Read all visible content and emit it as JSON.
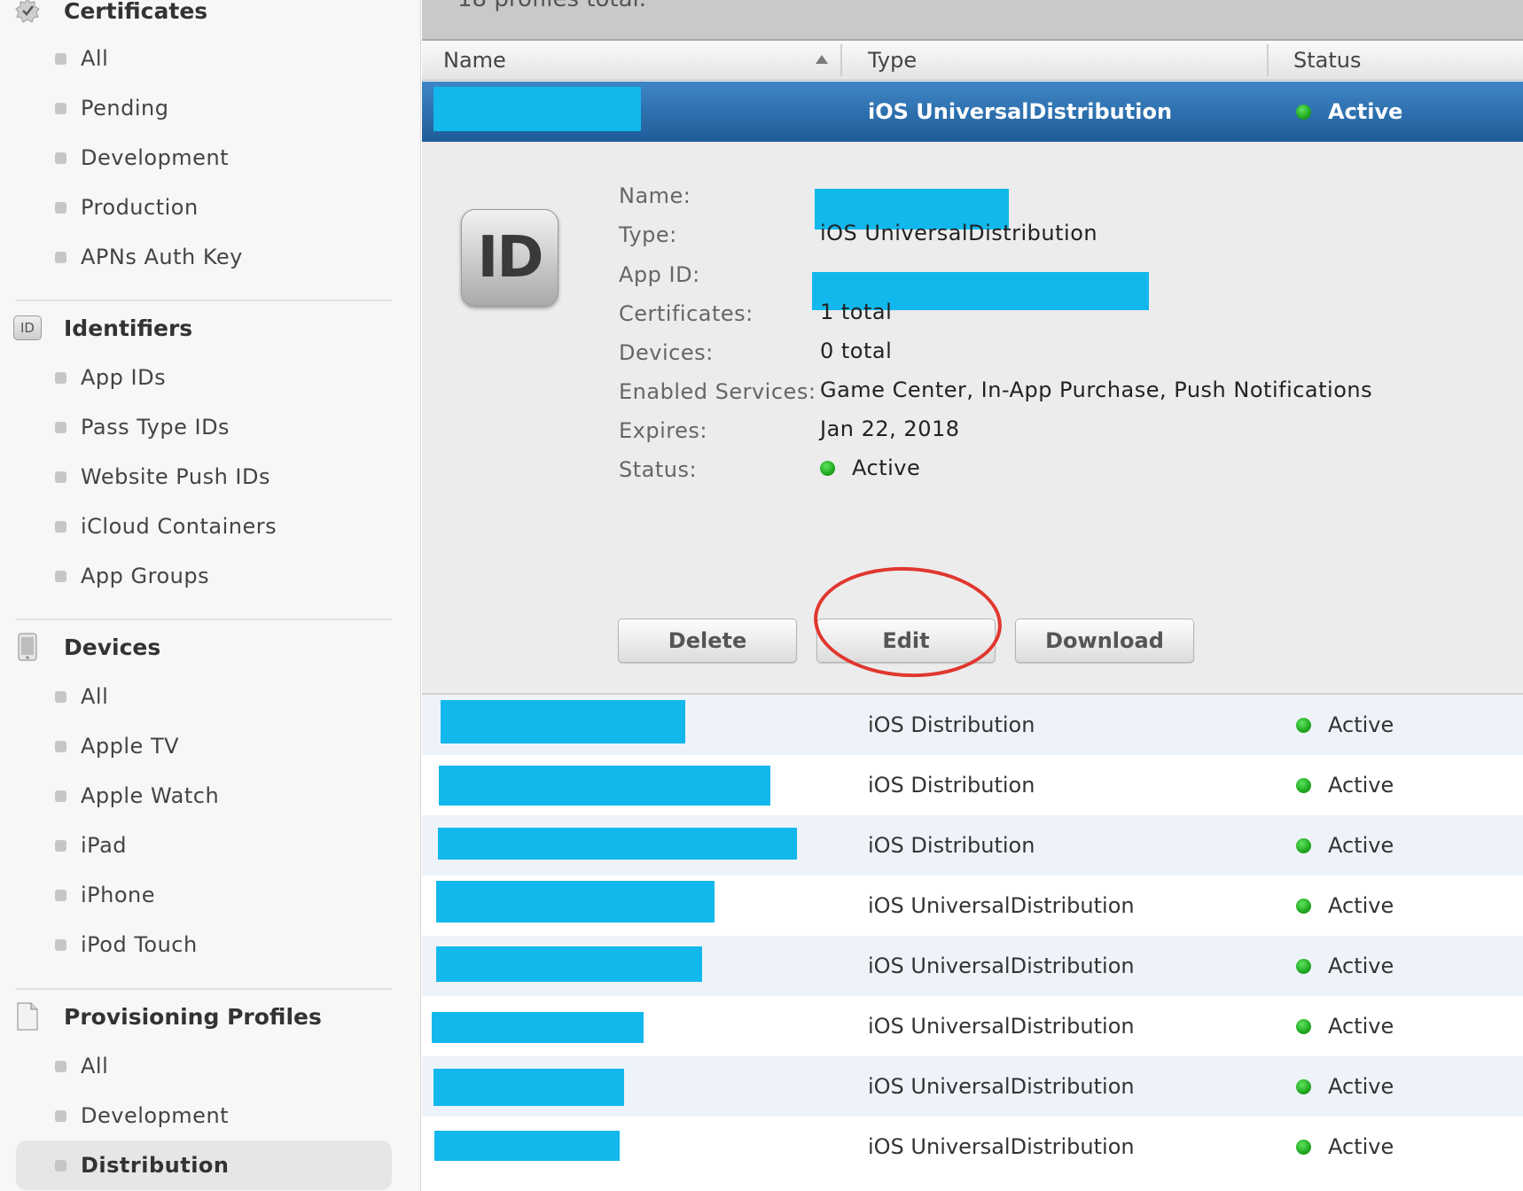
{
  "sidebar": {
    "certificates": {
      "title": "Certificates",
      "items": [
        "All",
        "Pending",
        "Development",
        "Production",
        "APNs Auth Key"
      ]
    },
    "identifiers": {
      "title": "Identifiers",
      "icon_text": "ID",
      "items": [
        "App IDs",
        "Pass Type IDs",
        "Website Push IDs",
        "iCloud Containers",
        "App Groups"
      ]
    },
    "devices": {
      "title": "Devices",
      "items": [
        "All",
        "Apple TV",
        "Apple Watch",
        "iPad",
        "iPhone",
        "iPod Touch"
      ]
    },
    "profiles": {
      "title": "Provisioning Profiles",
      "items": [
        "All",
        "Development",
        "Distribution"
      ],
      "selected": "Distribution"
    }
  },
  "header": {
    "total_text": "18 profiles total.",
    "columns": {
      "name": "Name",
      "type": "Type",
      "status": "Status"
    }
  },
  "selected_row": {
    "type": "iOS UniversalDistribution",
    "status": "Active"
  },
  "detail": {
    "icon_text": "ID",
    "labels": {
      "name": "Name:",
      "type": "Type:",
      "app_id": "App ID:",
      "certificates": "Certificates:",
      "devices": "Devices:",
      "services": "Enabled Services:",
      "expires": "Expires:",
      "status": "Status:"
    },
    "values": {
      "type": "iOS UniversalDistribution",
      "certificates": "1 total",
      "devices": "0 total",
      "services": "Game Center, In-App Purchase, Push Notifications",
      "expires": "Jan 22, 2018",
      "status": "Active"
    },
    "buttons": {
      "delete": "Delete",
      "edit": "Edit",
      "download": "Download"
    }
  },
  "rows": [
    {
      "type": "iOS Distribution",
      "status": "Active"
    },
    {
      "type": "iOS Distribution",
      "status": "Active"
    },
    {
      "type": "iOS Distribution",
      "status": "Active"
    },
    {
      "type": "iOS UniversalDistribution",
      "status": "Active"
    },
    {
      "type": "iOS UniversalDistribution",
      "status": "Active"
    },
    {
      "type": "iOS UniversalDistribution",
      "status": "Active"
    },
    {
      "type": "iOS UniversalDistribution",
      "status": "Active"
    },
    {
      "type": "iOS UniversalDistribution",
      "status": "Active"
    }
  ],
  "colors": {
    "selected_row": "#2a6fb0",
    "redaction": "#12b8ec",
    "status_dot": "#22b422",
    "annotation_circle": "#e0372f",
    "alt_row": "#eef3fa"
  }
}
